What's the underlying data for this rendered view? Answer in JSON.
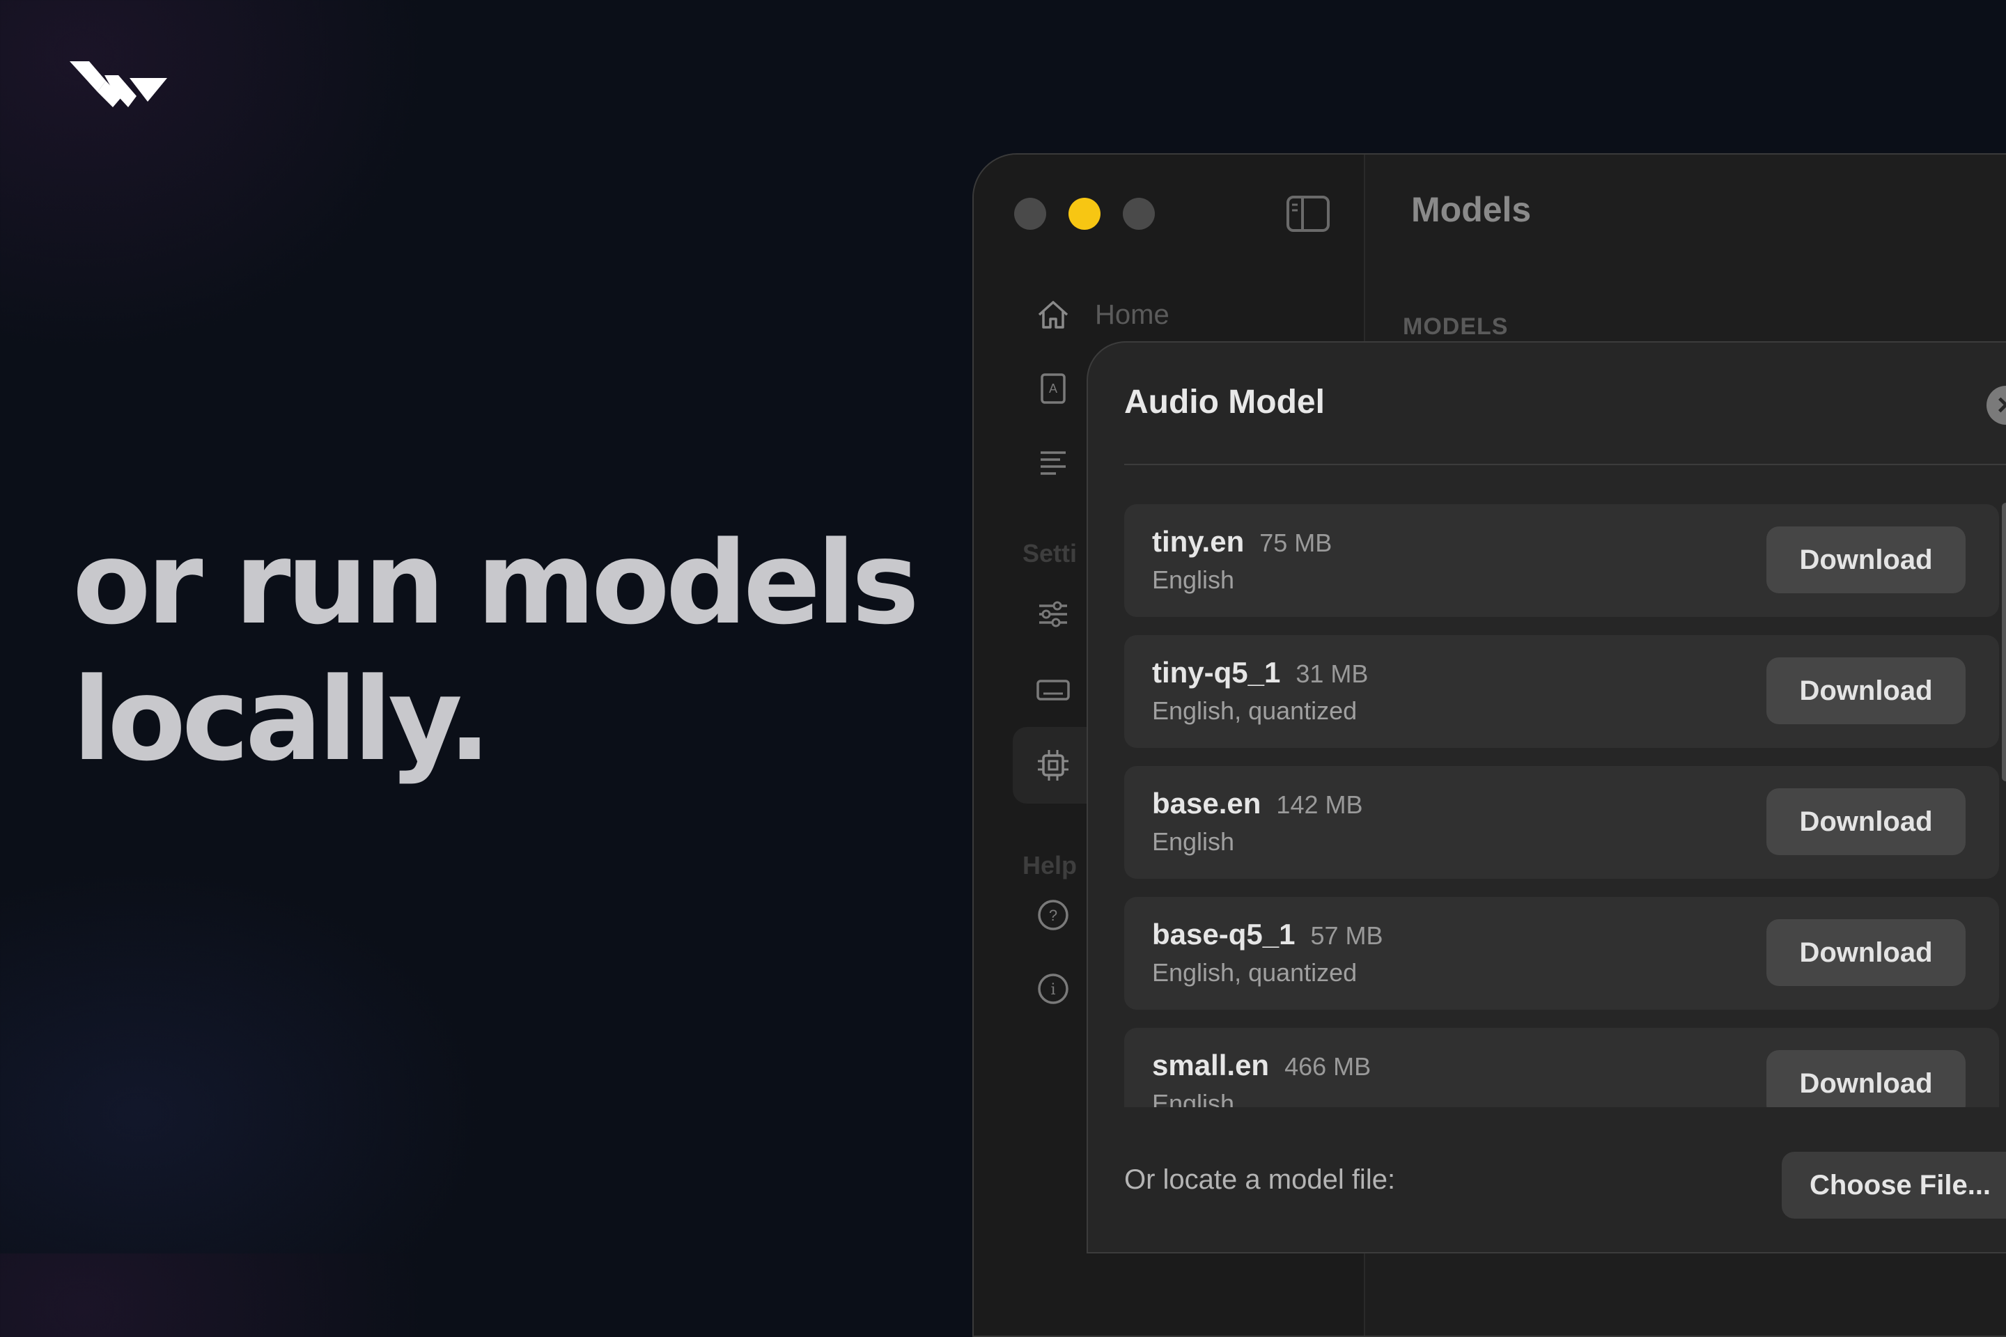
{
  "headline": {
    "line1": "or run models",
    "line2": "locally."
  },
  "window": {
    "title": "Models",
    "section": "MODELS",
    "sidebar": {
      "items": [
        {
          "label": "Home",
          "icon": "home-icon"
        },
        {
          "label": "",
          "icon": "dictionary-icon"
        },
        {
          "label": "",
          "icon": "text-lines-icon"
        },
        {
          "label": "",
          "icon": "sliders-icon"
        },
        {
          "label": "",
          "icon": "keyboard-icon"
        },
        {
          "label": "",
          "icon": "chip-icon"
        },
        {
          "label": "",
          "icon": "help-icon"
        },
        {
          "label": "",
          "icon": "info-icon"
        }
      ],
      "settings_label": "Setti",
      "help_label": "Help"
    }
  },
  "dialog": {
    "title": "Audio Model",
    "close_label": "×",
    "models": [
      {
        "name": "tiny.en",
        "size": "75 MB",
        "desc": "English",
        "button": "Download"
      },
      {
        "name": "tiny-q5_1",
        "size": "31 MB",
        "desc": "English, quantized",
        "button": "Download"
      },
      {
        "name": "base.en",
        "size": "142 MB",
        "desc": "English",
        "button": "Download"
      },
      {
        "name": "base-q5_1",
        "size": "57 MB",
        "desc": "English, quantized",
        "button": "Download"
      },
      {
        "name": "small.en",
        "size": "466 MB",
        "desc": "English",
        "button": "Download"
      }
    ],
    "footer_label": "Or locate a model file:",
    "choose_button": "Choose File..."
  },
  "colors": {
    "accent_yellow": "#f7c613",
    "background": "#0b0f18",
    "dialog_bg": "#262626"
  }
}
